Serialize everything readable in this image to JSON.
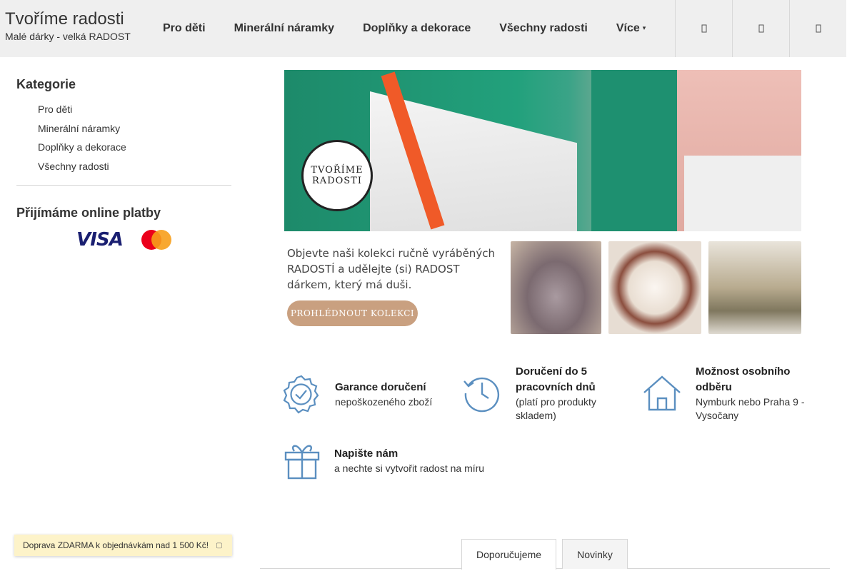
{
  "header": {
    "title": "Tvoříme radosti",
    "subtitle": "Malé dárky - velká RADOST",
    "nav": [
      {
        "label": "Pro děti"
      },
      {
        "label": "Minerální náramky"
      },
      {
        "label": "Doplňky a dekorace"
      },
      {
        "label": "Všechny radosti"
      },
      {
        "label": "Více"
      }
    ]
  },
  "sidebar": {
    "categories_heading": "Kategorie",
    "categories": [
      {
        "label": "Pro děti"
      },
      {
        "label": "Minerální náramky"
      },
      {
        "label": "Doplňky a dekorace"
      },
      {
        "label": "Všechny radosti"
      }
    ],
    "payments_heading": "Přijímáme online platby",
    "visa": "VISA"
  },
  "banner": {
    "logo_line1": "TVOŘÍME",
    "logo_line2": "RADOSTI",
    "text": "Objevte naši kolekci ručně vyráběných RADOSTÍ a udělejte (si) RADOST dárkem, který má duši.",
    "button": "PROHLÉDNOUT KOLEKCI"
  },
  "features": [
    {
      "title": "Garance doručení",
      "text": "nepoškozeného zboží"
    },
    {
      "title": "Doručení do 5 pracovních dnů",
      "text": "(platí pro produkty skladem)"
    },
    {
      "title": "Možnost osobního odběru",
      "text": "Nymburk nebo Praha 9 - Vysočany"
    },
    {
      "title": "Napište nám",
      "text": "a nechte si vytvořit radost na míru"
    }
  ],
  "tabs": [
    {
      "label": "Doporučujeme"
    },
    {
      "label": "Novinky"
    }
  ],
  "shipping_bar": {
    "text": "Doprava ZDARMA k objednávkám nad 1 500 Kč!"
  },
  "colors": {
    "accent": "#5b8fc0",
    "header_bg": "#efefef",
    "button": "#c9a080"
  }
}
